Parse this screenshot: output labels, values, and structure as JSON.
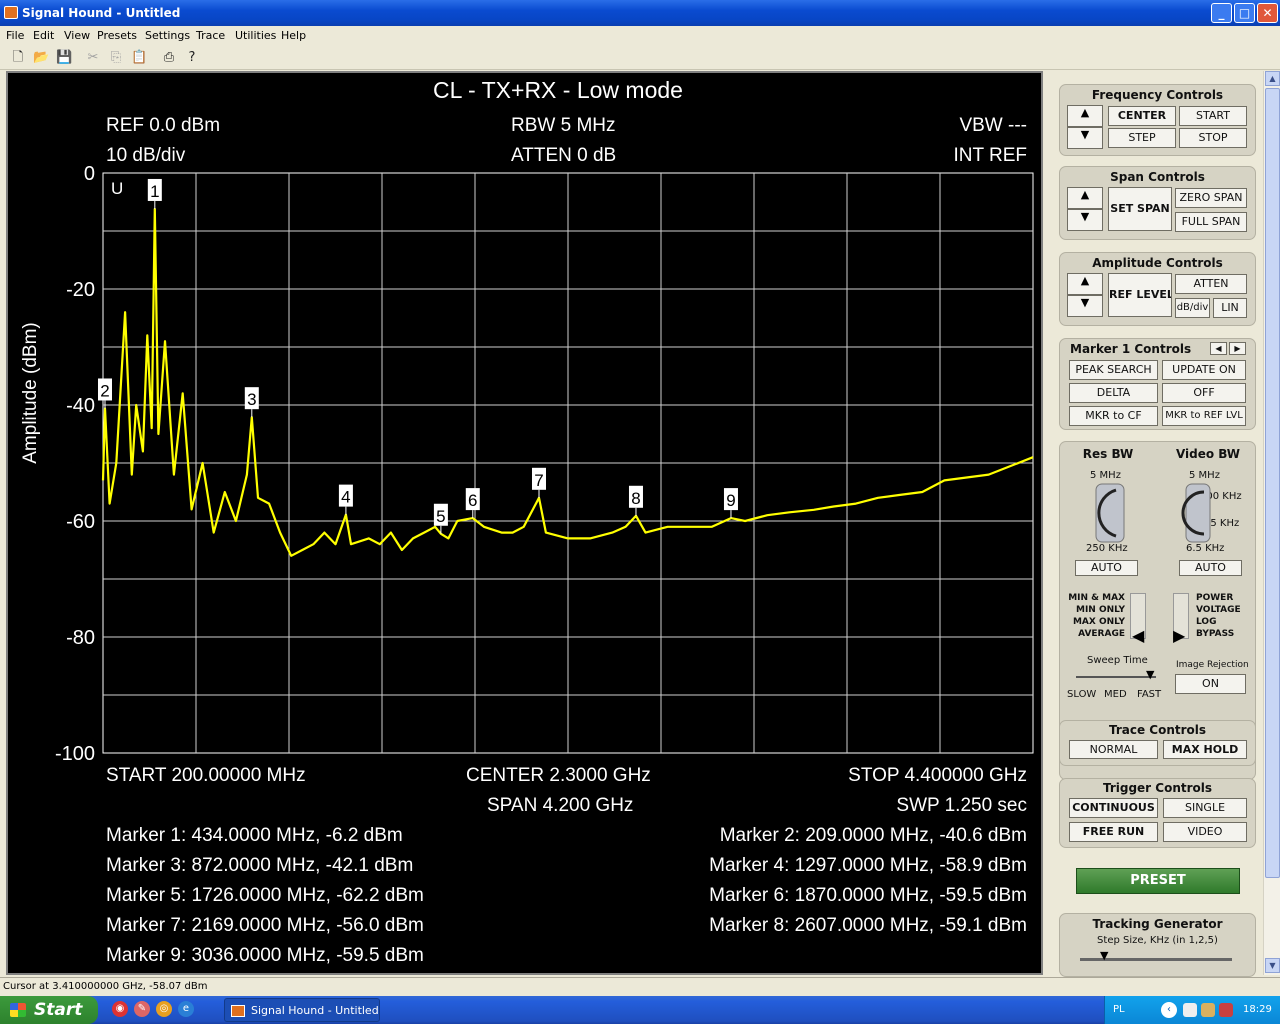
{
  "window": {
    "title": "Signal Hound - Untitled",
    "buttons": {
      "minimize": "_",
      "maximize": "□",
      "close": "✕"
    }
  },
  "menu": [
    "File",
    "Edit",
    "View",
    "Presets",
    "Settings",
    "Trace",
    "Utilities",
    "Help"
  ],
  "toolbar": {
    "icons": [
      "new-icon",
      "open-icon",
      "save-icon",
      "cut-icon",
      "copy-icon",
      "paste-icon",
      "print-icon",
      "help-icon"
    ]
  },
  "display": {
    "title": "CL - TX+RX - Low mode",
    "ref": "REF 0.0 dBm",
    "scale": "10 dB/div",
    "rbw": "RBW 5 MHz",
    "atten": "ATTEN 0 dB",
    "vbw": "VBW ---",
    "intref": "INT REF",
    "start": "START 200.00000 MHz",
    "center": "CENTER 2.3000 GHz",
    "stop": "STOP 4.400000 GHz",
    "span": "SPAN 4.200 GHz",
    "swp": "SWP 1.250 sec",
    "u_flag": "U",
    "markers_left": [
      "Marker 1: 434.0000 MHz, -6.2 dBm",
      "Marker 3: 872.0000 MHz, -42.1 dBm",
      "Marker 5: 1726.0000 MHz, -62.2 dBm",
      "Marker 7: 2169.0000 MHz, -56.0 dBm",
      "Marker 9: 3036.0000 MHz, -59.5 dBm"
    ],
    "markers_right": [
      "Marker 2: 209.0000 MHz, -40.6 dBm",
      "Marker 4: 1297.0000 MHz, -58.9 dBm",
      "Marker 6: 1870.0000 MHz, -59.5 dBm",
      "Marker 8: 2607.0000 MHz, -59.1 dBm"
    ]
  },
  "chart_data": {
    "type": "line",
    "title": "CL - TX+RX - Low mode",
    "ylabel": "Amplitude (dBm)",
    "xlabel": "",
    "xlim_mhz": [
      200,
      4400
    ],
    "ylim": [
      -100,
      0
    ],
    "y_ticks": [
      "0",
      "-20",
      "-40",
      "-60",
      "-80",
      "-100"
    ],
    "grid": true,
    "trace_color": "#ffff00",
    "series": [
      {
        "x_mhz": [
          200,
          209,
          230,
          260,
          300,
          330,
          350,
          380,
          400,
          420,
          434,
          450,
          480,
          520,
          560,
          600,
          650,
          700,
          750,
          800,
          850,
          872,
          900,
          950,
          1000,
          1050,
          1100,
          1150,
          1200,
          1250,
          1297,
          1320,
          1400,
          1450,
          1500,
          1550,
          1600,
          1650,
          1700,
          1726,
          1760,
          1800,
          1870,
          1920,
          2000,
          2050,
          2100,
          2169,
          2200,
          2300,
          2400,
          2500,
          2560,
          2607,
          2650,
          2750,
          2850,
          2950,
          3036,
          3100,
          3200,
          3300,
          3410,
          3500,
          3600,
          3700,
          3800,
          3900,
          4000,
          4100,
          4200,
          4300,
          4400
        ],
        "y_dbm": [
          -53,
          -40.6,
          -57,
          -50,
          -24,
          -52,
          -40,
          -48,
          -28,
          -44,
          -6.2,
          -45,
          -29,
          -52,
          -38,
          -58,
          -50,
          -62,
          -55,
          -60,
          -52,
          -42.1,
          -56,
          -57,
          -62,
          -66,
          -65,
          -64,
          -62,
          -64,
          -58.9,
          -64,
          -63,
          -64,
          -62,
          -65,
          -63,
          -62,
          -61,
          -62.2,
          -63,
          -60,
          -59.5,
          -61,
          -62,
          -62,
          -61,
          -56,
          -62,
          -63,
          -63,
          -62,
          -61,
          -59.1,
          -62,
          -61,
          -61,
          -61,
          -59.5,
          -60,
          -59,
          -58.5,
          -58.07,
          -57.5,
          -57,
          -56,
          -55.5,
          -55,
          -53,
          -52.5,
          -52,
          -50.5,
          -49
        ]
      }
    ],
    "markers": [
      {
        "label": "1",
        "x_mhz": 434,
        "y_dbm": -6.2
      },
      {
        "label": "2",
        "x_mhz": 209,
        "y_dbm": -40.6
      },
      {
        "label": "3",
        "x_mhz": 872,
        "y_dbm": -42.1
      },
      {
        "label": "4",
        "x_mhz": 1297,
        "y_dbm": -58.9
      },
      {
        "label": "5",
        "x_mhz": 1726,
        "y_dbm": -62.2
      },
      {
        "label": "6",
        "x_mhz": 1870,
        "y_dbm": -59.5
      },
      {
        "label": "7",
        "x_mhz": 2169,
        "y_dbm": -56.0
      },
      {
        "label": "8",
        "x_mhz": 2607,
        "y_dbm": -59.1
      },
      {
        "label": "9",
        "x_mhz": 3036,
        "y_dbm": -59.5
      }
    ]
  },
  "panel": {
    "freq": {
      "title": "Frequency Controls",
      "center": "CENTER",
      "start": "START",
      "step": "STEP",
      "stop": "STOP"
    },
    "span": {
      "title": "Span Controls",
      "set_span": "SET SPAN",
      "zero_span": "ZERO SPAN",
      "full_span": "FULL SPAN"
    },
    "amp": {
      "title": "Amplitude Controls",
      "ref_level": "REF LEVEL",
      "atten": "ATTEN",
      "dbdiv": "dB/div",
      "lin": "LIN"
    },
    "marker": {
      "title": "Marker 1 Controls",
      "peak_search": "PEAK SEARCH",
      "update_on": "UPDATE ON",
      "delta": "DELTA",
      "off": "OFF",
      "mkr_cf": "MKR to CF",
      "mkr_ref": "MKR to REF LVL"
    },
    "resbw": {
      "title": "Res BW",
      "top": "5 MHz",
      "bottom": "250 KHz",
      "auto": "AUTO"
    },
    "vidbw": {
      "title": "Video BW",
      "top": "5 MHz",
      "t1": "100 KHz",
      "t2": "25 KHz",
      "bottom": "6.5 KHz",
      "auto": "AUTO"
    },
    "detector": [
      "MIN & MAX",
      "MIN ONLY",
      "MAX ONLY",
      "AVERAGE"
    ],
    "scale_mode": [
      "POWER",
      "VOLTAGE",
      "LOG",
      "BYPASS"
    ],
    "sweep": {
      "title": "Sweep Time",
      "slow": "SLOW",
      "med": "MED",
      "fast": "FAST",
      "level": "fast"
    },
    "imagerej": {
      "title": "Image Rejection",
      "value": "ON"
    },
    "trace": {
      "title": "Trace Controls",
      "normal": "NORMAL",
      "maxhold": "MAX HOLD"
    },
    "trigger": {
      "title": "Trigger Controls",
      "continuous": "CONTINUOUS",
      "single": "SINGLE",
      "free_run": "FREE RUN",
      "video": "VIDEO"
    },
    "preset": "PRESET",
    "tracking": {
      "title": "Tracking Generator",
      "step": "Step Size, KHz (in 1,2,5)"
    }
  },
  "status": "Cursor at 3.410000000 GHz, -58.07 dBm",
  "taskbar": {
    "start": "Start",
    "item": "Signal Hound - Untitled",
    "lang": "PL",
    "time": "18:29"
  }
}
